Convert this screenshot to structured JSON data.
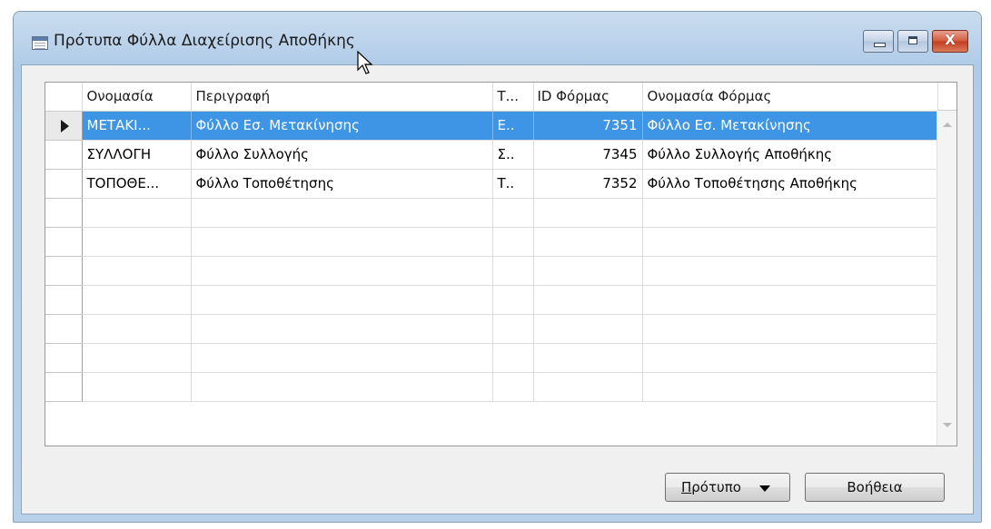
{
  "window": {
    "title": "Πρότυπα Φύλλα Διαχείρισης Αποθήκης",
    "icon": "form-window-icon",
    "caption_buttons": {
      "minimize": "minimize-icon",
      "maximize": "maximize-icon",
      "close": "close-icon",
      "close_glyph": "X"
    }
  },
  "grid": {
    "columns": [
      "Ονομασία",
      "Περιγραφή",
      "Τ...",
      "ID Φόρμας",
      "Ονομασία Φόρμας"
    ],
    "rows": [
      {
        "name": "ΜΕΤΑΚΙ...",
        "description": "Φύλλο Εσ. Μετακίνησης",
        "type": "Ε..",
        "form_id": "7351",
        "form_name": "Φύλλο Εσ. Μετακίνησης",
        "selected": true
      },
      {
        "name": "ΣΥΛΛΟΓΗ",
        "description": "Φύλλο Συλλογής",
        "type": "Σ..",
        "form_id": "7345",
        "form_name": "Φύλλο Συλλογής Αποθήκης",
        "selected": false
      },
      {
        "name": "ΤΟΠΟΘΕ...",
        "description": "Φύλλο Τοποθέτησης",
        "type": "Τ..",
        "form_id": "7352",
        "form_name": "Φύλλο Τοποθέτησης Αποθήκης",
        "selected": false
      }
    ],
    "empty_rows": 7,
    "selection_color": "#3f95e5"
  },
  "buttons": {
    "template_label_first": "Π",
    "template_label_rest": "ρότυπο",
    "help_label": "Βοήθεια"
  }
}
